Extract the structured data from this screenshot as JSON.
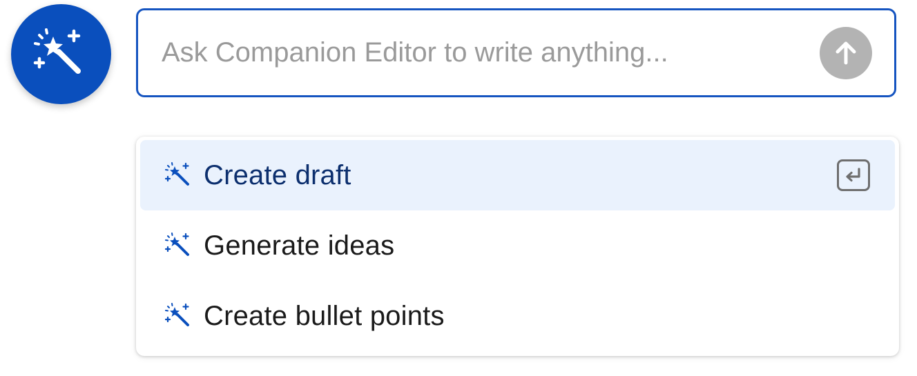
{
  "assistant": {
    "avatar_icon": "magic-wand-icon"
  },
  "prompt": {
    "placeholder": "Ask Companion Editor to write anything...",
    "value": "",
    "send_icon": "arrow-up-icon"
  },
  "suggestions": {
    "items": [
      {
        "label": "Create draft",
        "icon": "magic-wand-icon",
        "active": true,
        "shortcut_icon": "enter-key-icon"
      },
      {
        "label": "Generate ideas",
        "icon": "magic-wand-icon",
        "active": false
      },
      {
        "label": "Create bullet points",
        "icon": "magic-wand-icon",
        "active": false
      }
    ]
  },
  "colors": {
    "accent": "#0a4fbd",
    "input_border": "#1554c0",
    "active_row": "#eaf2fd",
    "send_disabled": "#b3b3b3"
  }
}
